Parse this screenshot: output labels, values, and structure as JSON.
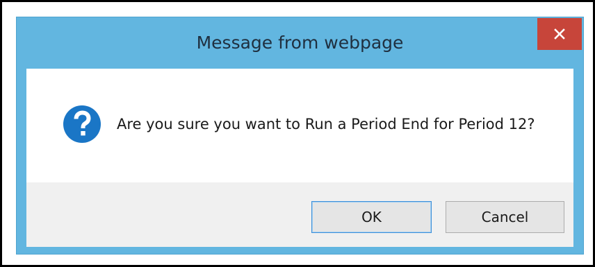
{
  "dialog": {
    "title": "Message from webpage",
    "close_icon": "close-x-icon",
    "message_icon": "question-mark-icon",
    "message": "Are you sure you want to Run a Period End for Period 12?",
    "buttons": {
      "ok_label": "OK",
      "cancel_label": "Cancel"
    }
  },
  "colors": {
    "titlebar": "#62b6e0",
    "close_button": "#c7453a",
    "icon_blue": "#1a76c6",
    "footer": "#f0f0f0"
  }
}
